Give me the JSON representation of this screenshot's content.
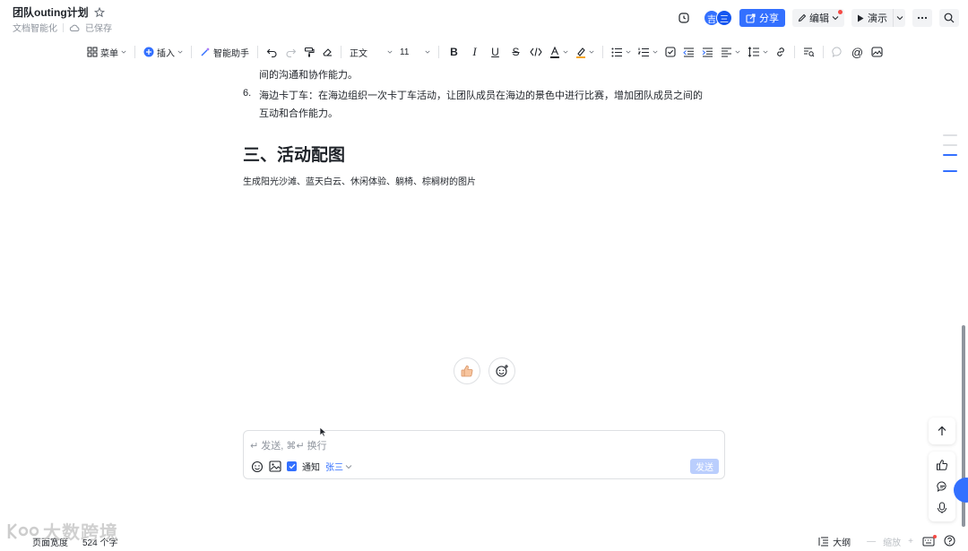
{
  "header": {
    "title": "团队outing计划",
    "subtitle_left": "文档智能化",
    "saved_status": "已保存",
    "avatars": [
      "吉",
      "三"
    ],
    "share_label": "分享",
    "edit_label": "编辑",
    "present_label": "演示"
  },
  "toolbar": {
    "menu_label": "菜单",
    "insert_label": "插入",
    "ai_label": "智能助手",
    "style_label": "正文",
    "font_size": "11"
  },
  "document": {
    "prev_line_tail": "间的沟通和协作能力。",
    "item6_number": "6.",
    "item6_line1": "海边卡丁车：在海边组织一次卡丁车活动，让团队成员在海边的景色中进行比赛，增加团队成员之间的",
    "item6_line2": "互动和合作能力。",
    "heading": "三、活动配图",
    "paragraph": "生成阳光沙滩、蓝天白云、休闲体验、躺椅、棕榈树的图片"
  },
  "comment": {
    "placeholder": "↵ 发送, ⌘↵ 换行",
    "notify_label": "通知",
    "mention_name": "张三",
    "send_label": "发送"
  },
  "statusbar": {
    "page_overview": "页面宽度",
    "word_count": "524 个字",
    "outline_label": "大纲",
    "zoom_label": "缩放"
  },
  "watermark": {
    "text": "大数跨境"
  },
  "colors": {
    "accent": "#3370ff",
    "text": "#1f2329",
    "muted": "#8f959e"
  }
}
